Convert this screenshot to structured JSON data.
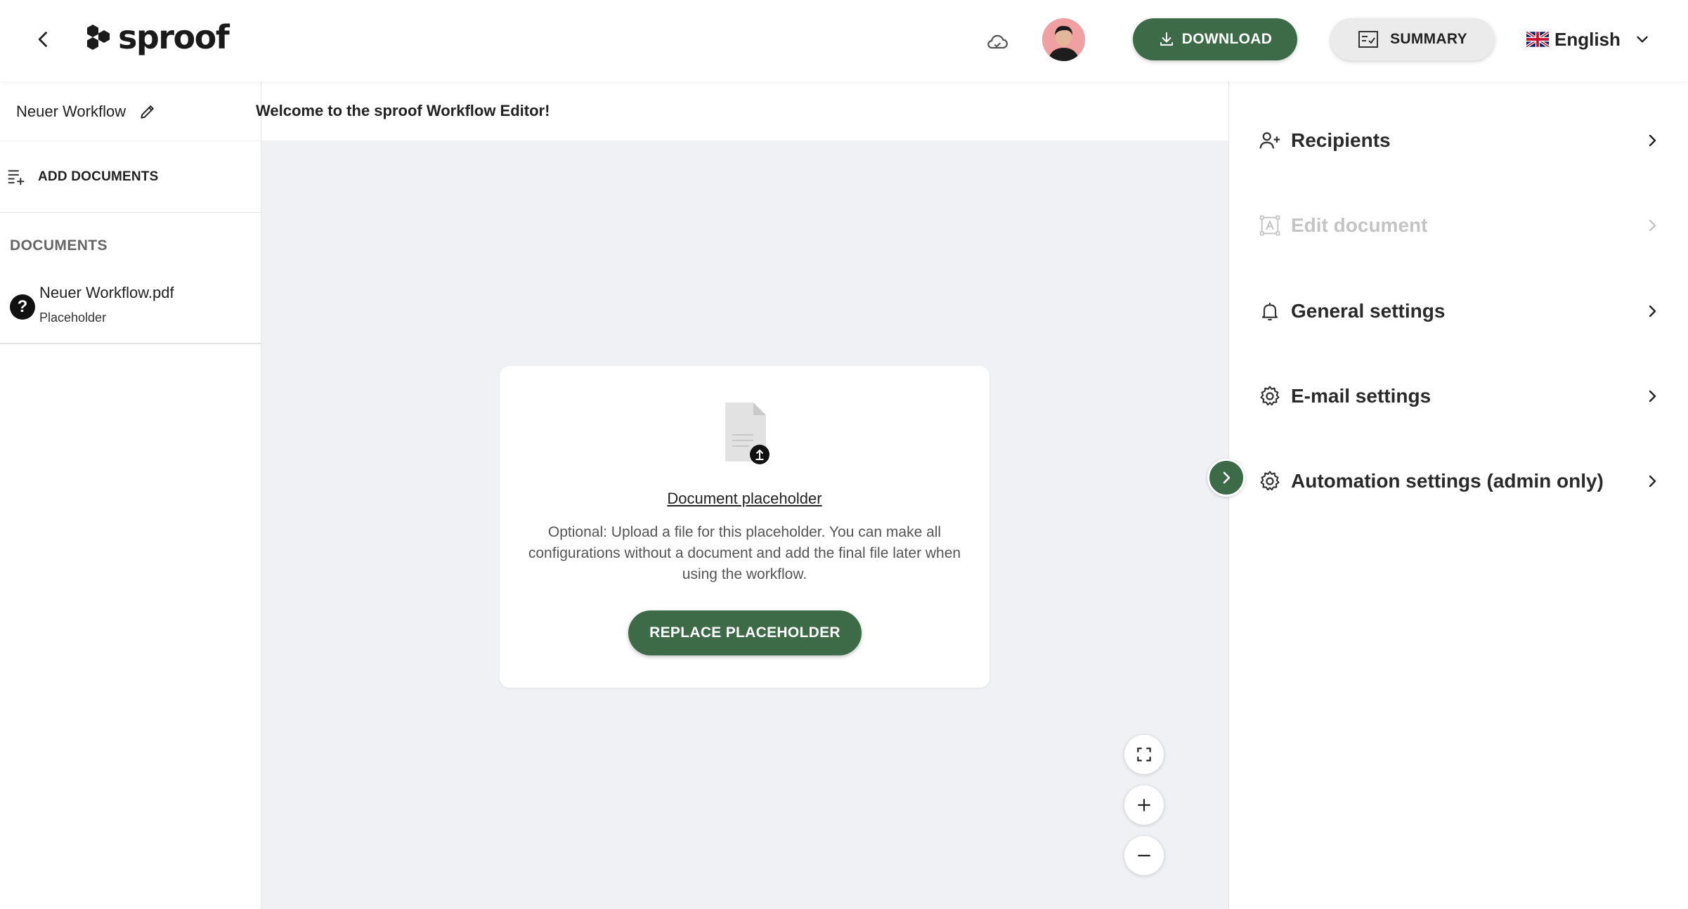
{
  "header": {
    "logo_text": "sproof",
    "download_label": "DOWNLOAD",
    "summary_label": "SUMMARY",
    "language": "English"
  },
  "left": {
    "workflow_name": "Neuer Workflow",
    "add_documents_label": "ADD DOCUMENTS",
    "documents_heading": "DOCUMENTS",
    "documents": [
      {
        "name": "Neuer Workflow.pdf",
        "subtitle": "Placeholder",
        "status_glyph": "?"
      }
    ]
  },
  "center": {
    "welcome": "Welcome to the sproof Workflow Editor!",
    "card": {
      "title": "Document placeholder",
      "description": "Optional: Upload a file for this placeholder. You can make all configurations without a document and add the final file later when using the workflow.",
      "button_label": "REPLACE PLACEHOLDER"
    }
  },
  "right": {
    "items": [
      {
        "label": "Recipients",
        "icon": "add-user-icon",
        "enabled": true
      },
      {
        "label": "Edit document",
        "icon": "edit-document-icon",
        "enabled": false
      },
      {
        "label": "General settings",
        "icon": "bell-icon",
        "enabled": true
      },
      {
        "label": "E-mail settings",
        "icon": "gear-icon",
        "enabled": true
      },
      {
        "label": "Automation settings (admin only)",
        "icon": "gear-icon",
        "enabled": true
      }
    ]
  },
  "colors": {
    "accent": "#3d6b47",
    "canvas": "#f0f1f5",
    "disabled": "#c4c4c4"
  }
}
